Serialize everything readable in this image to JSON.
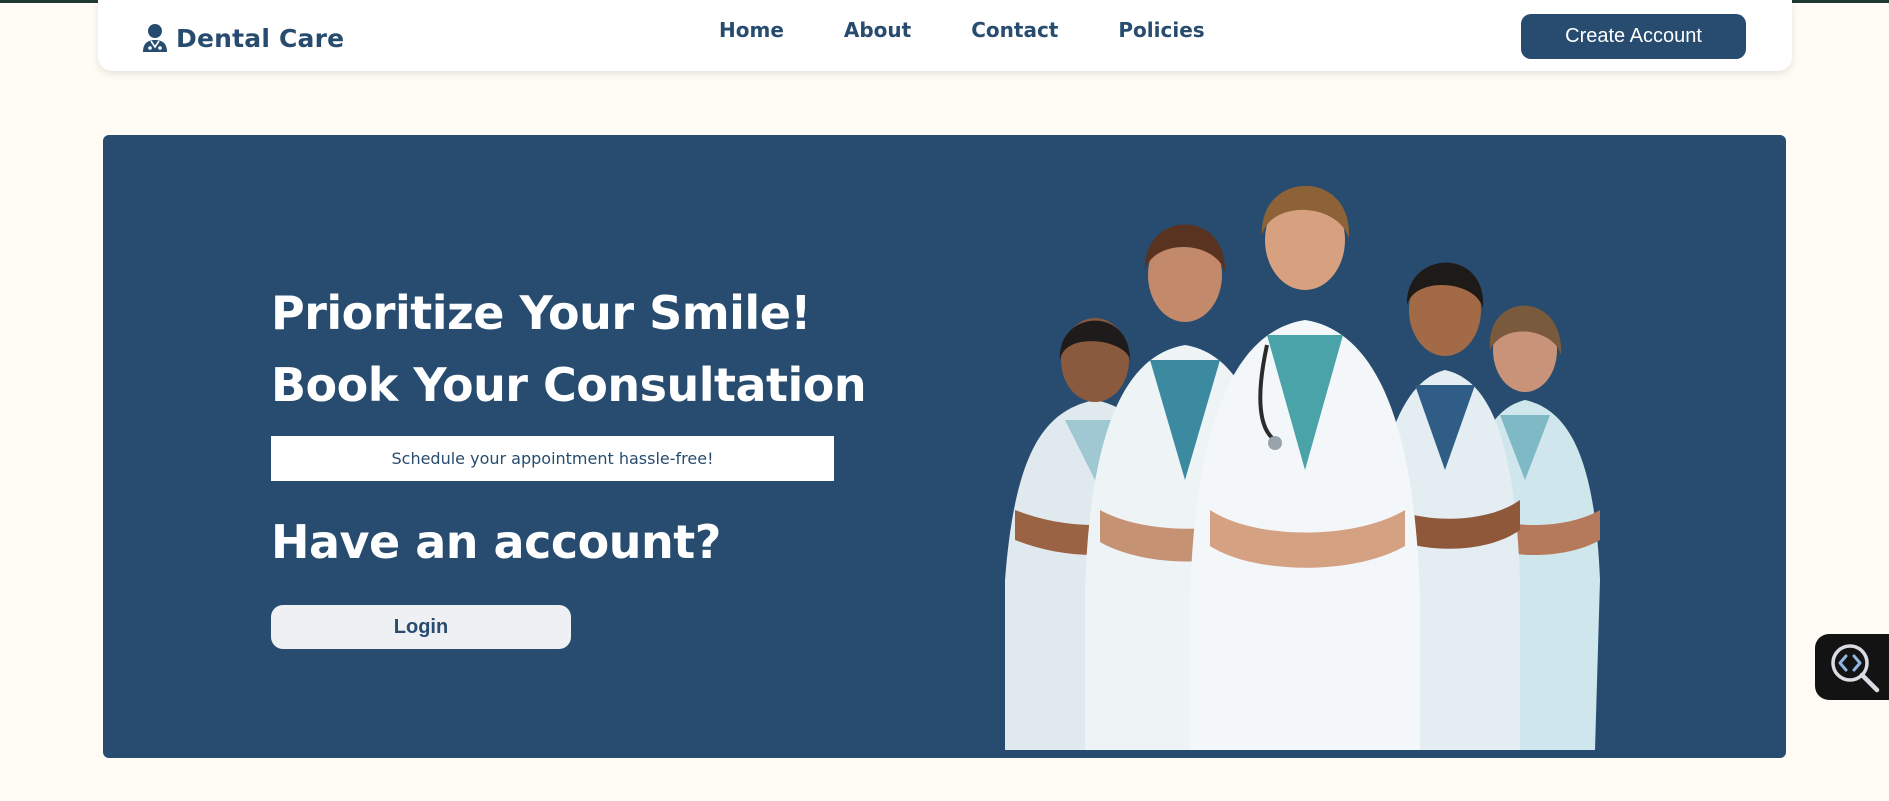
{
  "colors": {
    "brand": "#274c6f",
    "page_background": "#fefcf4",
    "hero_background": "#274c6f",
    "top_strip": "#1e3a33"
  },
  "header": {
    "brand_icon": "doctor-user-icon",
    "brand_name": "Dental Care",
    "nav": [
      {
        "label": "Home"
      },
      {
        "label": "About"
      },
      {
        "label": "Contact"
      },
      {
        "label": "Policies"
      }
    ],
    "create_account_label": "Create Account"
  },
  "hero": {
    "title_line1": "Prioritize Your Smile!",
    "title_line2": "Book Your Consultation",
    "schedule_text": "Schedule your appointment hassle-free!",
    "account_question": "Have an account?",
    "login_label": "Login",
    "illustration": "medical-team-illustration"
  },
  "widgets": {
    "inspector_icon": "code-search-icon"
  }
}
